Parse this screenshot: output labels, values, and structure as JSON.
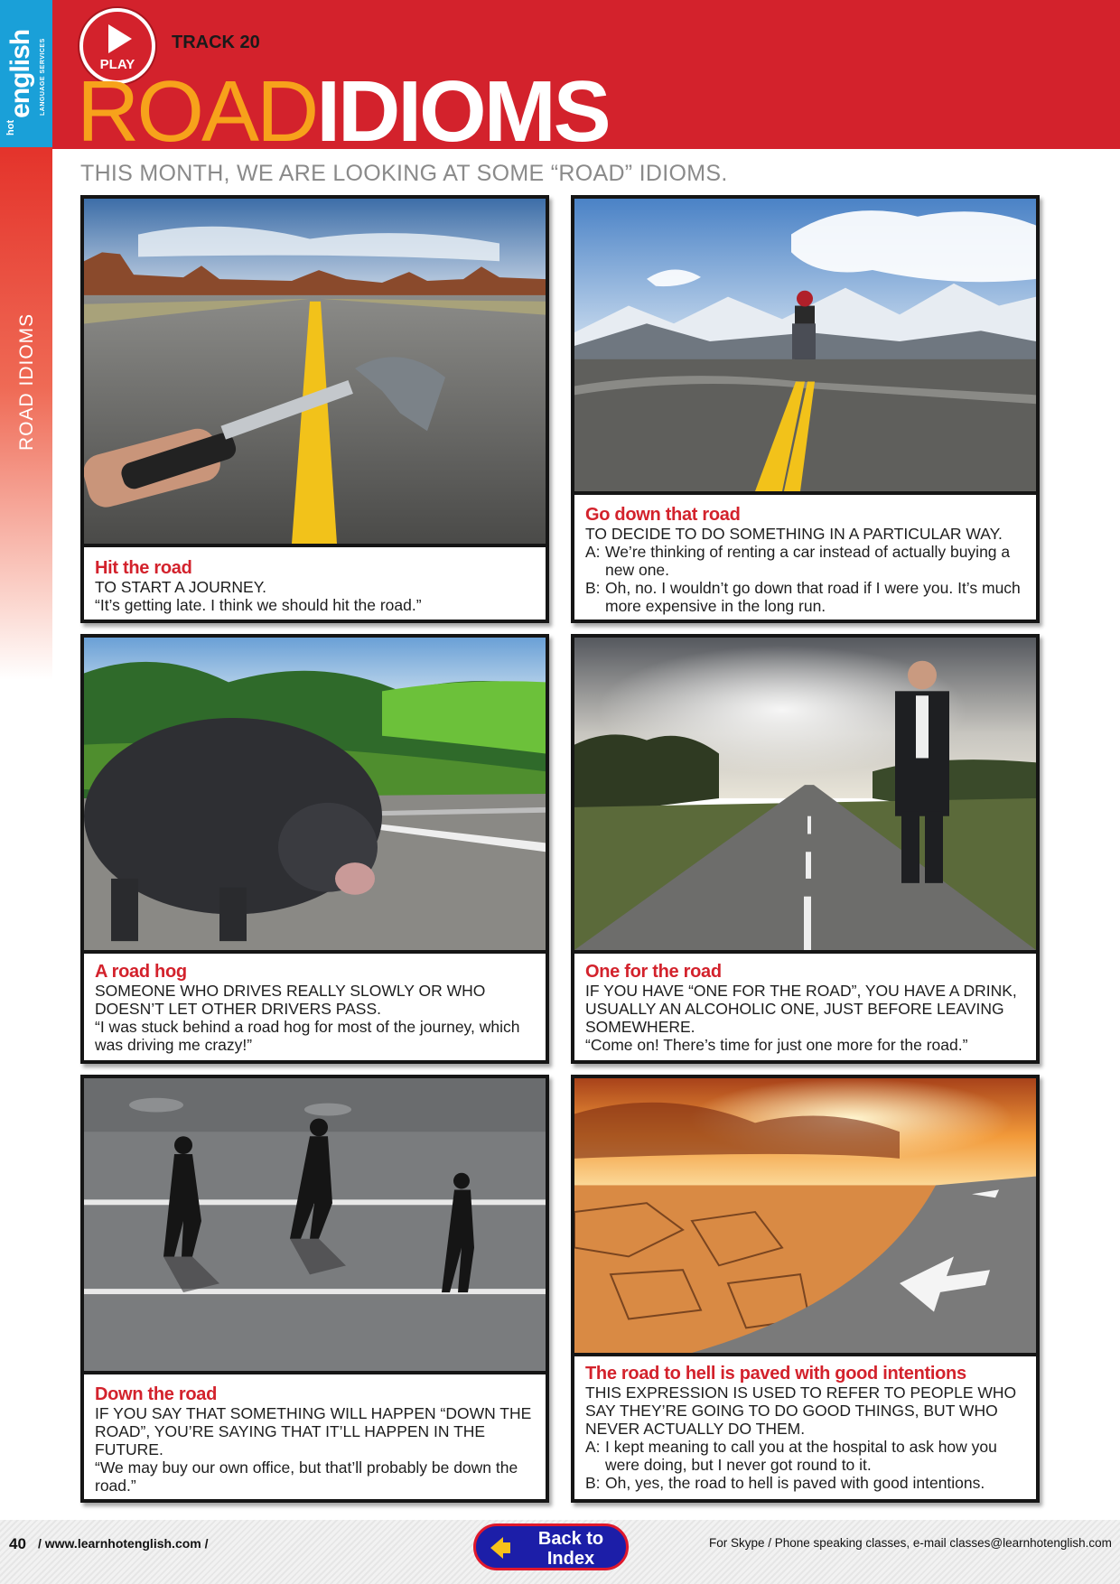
{
  "logo": {
    "hot": "hot",
    "english": "english",
    "sub": "LANGUAGE SERVICES"
  },
  "header": {
    "play_label": "PLAY",
    "track": "TRACK 20",
    "title_part1": "ROAD",
    "title_part2": "IDIOMS"
  },
  "side_label": "ROAD IDIOMS",
  "intro": "THIS MONTH, WE ARE LOOKING AT SOME “ROAD” IDIOMS.",
  "idioms": [
    {
      "title": "Hit the road",
      "definition": "TO START A JOURNEY.",
      "example": "“It’s getting late. I think we should hit the road.”"
    },
    {
      "title": "Go down that road",
      "definition": "TO DECIDE TO DO SOMETHING IN A PARTICULAR WAY.",
      "dialogue": [
        {
          "speaker": "A:",
          "line": "We’re thinking of renting a car instead of actually buying a new one."
        },
        {
          "speaker": "B:",
          "line": "Oh, no. I wouldn’t go down that road if I were you. It’s much more expensive in the long run."
        }
      ]
    },
    {
      "title": "A road hog",
      "definition": "SOMEONE WHO DRIVES REALLY SLOWLY OR WHO DOESN’T LET OTHER DRIVERS PASS.",
      "example": "“I was stuck behind a road hog for most of the journey, which was driving me crazy!”"
    },
    {
      "title": "One for the road",
      "definition": "IF YOU HAVE “ONE FOR THE ROAD”, YOU HAVE A DRINK, USUALLY AN ALCOHOLIC ONE, JUST BEFORE LEAVING SOMEWHERE.",
      "example": "“Come on! There’s time for just one more for the road.”"
    },
    {
      "title": "Down the road",
      "definition": "IF YOU SAY THAT SOMETHING WILL HAPPEN “DOWN THE ROAD”, YOU’RE SAYING THAT IT’LL HAPPEN IN THE FUTURE.",
      "example": "“We may buy our own office, but that’ll probably be down the road.”"
    },
    {
      "title": "The road to hell is paved with good intentions",
      "definition": "THIS EXPRESSION IS USED TO REFER TO PEOPLE WHO SAY THEY’RE GOING TO DO GOOD THINGS, BUT WHO NEVER ACTUALLY DO THEM.",
      "dialogue": [
        {
          "speaker": "A:",
          "line": "I kept meaning to call you at the hospital to ask how you were doing, but I never got round to it."
        },
        {
          "speaker": "B:",
          "line": "Oh, yes, the road to hell is paved with good intentions."
        }
      ]
    }
  ],
  "footer": {
    "page_number": "40",
    "url": "/ www.learnhotenglish.com /",
    "back_button": "Back to Index",
    "contact": "For Skype / Phone speaking classes, e-mail classes@learnhotenglish.com"
  },
  "colors": {
    "accent_red": "#d3222c",
    "title_orange": "#f7a21b",
    "logo_blue": "#1aa0d8",
    "button_blue": "#1c1ea8"
  }
}
